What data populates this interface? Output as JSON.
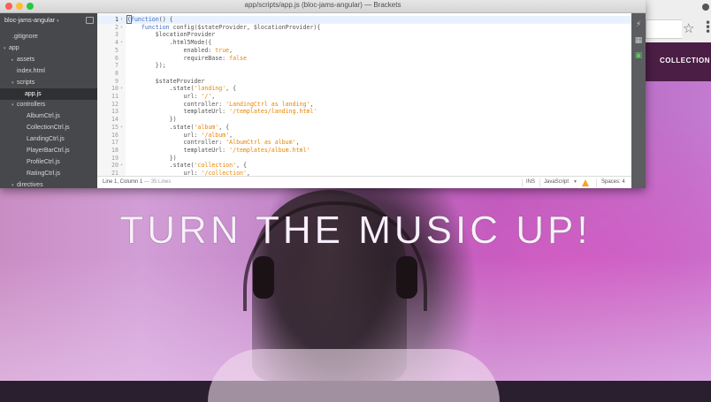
{
  "window": {
    "title": "app/scripts/app.js (bloc-jams-angular) — Brackets"
  },
  "sidebar": {
    "project_title": "bloc-jams-angular",
    "items": [
      {
        "label": ".gitignore",
        "arrow": ""
      },
      {
        "label": "app",
        "arrow": "▾"
      },
      {
        "label": "assets",
        "arrow": "▸"
      },
      {
        "label": "index.html",
        "arrow": ""
      },
      {
        "label": "scripts",
        "arrow": "▾"
      },
      {
        "label": "app.js",
        "arrow": ""
      },
      {
        "label": "controllers",
        "arrow": "▾"
      },
      {
        "label": "AlbumCtrl.js",
        "arrow": ""
      },
      {
        "label": "CollectionCtrl.js",
        "arrow": ""
      },
      {
        "label": "LandingCtrl.js",
        "arrow": ""
      },
      {
        "label": "PlayerBarCtrl.js",
        "arrow": ""
      },
      {
        "label": "ProfileCtrl.js",
        "arrow": ""
      },
      {
        "label": "RatingCtrl.js",
        "arrow": ""
      },
      {
        "label": "directives",
        "arrow": "▾"
      }
    ]
  },
  "editor": {
    "lines": [
      {
        "n": "1",
        "fold": "▾",
        "tokens": [
          {
            "t": "(",
            "c": "cursor"
          },
          {
            "t": "function",
            "c": "kw"
          },
          {
            "t": "() {",
            "c": "plain"
          }
        ]
      },
      {
        "n": "2",
        "fold": "▾",
        "tokens": [
          {
            "t": "    ",
            "c": "plain"
          },
          {
            "t": "function",
            "c": "kw"
          },
          {
            "t": " config($stateProvider, $locationProvider){",
            "c": "plain"
          }
        ]
      },
      {
        "n": "3",
        "fold": "",
        "tokens": [
          {
            "t": "        $locationProvider",
            "c": "plain"
          }
        ]
      },
      {
        "n": "4",
        "fold": "▾",
        "tokens": [
          {
            "t": "            .html5Mode({",
            "c": "plain"
          }
        ]
      },
      {
        "n": "5",
        "fold": "",
        "tokens": [
          {
            "t": "                enabled: ",
            "c": "plain"
          },
          {
            "t": "true",
            "c": "bool"
          },
          {
            "t": ",",
            "c": "plain"
          }
        ]
      },
      {
        "n": "6",
        "fold": "",
        "tokens": [
          {
            "t": "                requireBase: ",
            "c": "plain"
          },
          {
            "t": "false",
            "c": "bool"
          }
        ]
      },
      {
        "n": "7",
        "fold": "",
        "tokens": [
          {
            "t": "        });",
            "c": "plain"
          }
        ]
      },
      {
        "n": "8",
        "fold": "",
        "tokens": []
      },
      {
        "n": "9",
        "fold": "",
        "tokens": [
          {
            "t": "        $stateProvider",
            "c": "plain"
          }
        ]
      },
      {
        "n": "10",
        "fold": "▾",
        "tokens": [
          {
            "t": "            .state(",
            "c": "plain"
          },
          {
            "t": "'landing'",
            "c": "str"
          },
          {
            "t": ", {",
            "c": "plain"
          }
        ]
      },
      {
        "n": "11",
        "fold": "",
        "tokens": [
          {
            "t": "                url: ",
            "c": "plain"
          },
          {
            "t": "'/'",
            "c": "str"
          },
          {
            "t": ",",
            "c": "plain"
          }
        ]
      },
      {
        "n": "12",
        "fold": "",
        "tokens": [
          {
            "t": "                controller: ",
            "c": "plain"
          },
          {
            "t": "'LandingCtrl as landing'",
            "c": "str"
          },
          {
            "t": ",",
            "c": "plain"
          }
        ]
      },
      {
        "n": "13",
        "fold": "",
        "tokens": [
          {
            "t": "                templateUrl: ",
            "c": "plain"
          },
          {
            "t": "'/templates/landing.html'",
            "c": "str"
          }
        ]
      },
      {
        "n": "14",
        "fold": "",
        "tokens": [
          {
            "t": "            })",
            "c": "plain"
          }
        ]
      },
      {
        "n": "15",
        "fold": "▾",
        "tokens": [
          {
            "t": "            .state(",
            "c": "plain"
          },
          {
            "t": "'album'",
            "c": "str"
          },
          {
            "t": ", {",
            "c": "plain"
          }
        ]
      },
      {
        "n": "16",
        "fold": "",
        "tokens": [
          {
            "t": "                url: ",
            "c": "plain"
          },
          {
            "t": "'/album'",
            "c": "str"
          },
          {
            "t": ",",
            "c": "plain"
          }
        ]
      },
      {
        "n": "17",
        "fold": "",
        "tokens": [
          {
            "t": "                controller: ",
            "c": "plain"
          },
          {
            "t": "'AlbumCtrl as album'",
            "c": "str"
          },
          {
            "t": ",",
            "c": "plain"
          }
        ]
      },
      {
        "n": "18",
        "fold": "",
        "tokens": [
          {
            "t": "                templateUrl: ",
            "c": "plain"
          },
          {
            "t": "'/templates/album.html'",
            "c": "str"
          }
        ]
      },
      {
        "n": "19",
        "fold": "",
        "tokens": [
          {
            "t": "            })",
            "c": "plain"
          }
        ]
      },
      {
        "n": "20",
        "fold": "▾",
        "tokens": [
          {
            "t": "            .state(",
            "c": "plain"
          },
          {
            "t": "'collection'",
            "c": "str"
          },
          {
            "t": ", {",
            "c": "plain"
          }
        ]
      },
      {
        "n": "21",
        "fold": "",
        "tokens": [
          {
            "t": "                url: ",
            "c": "plain"
          },
          {
            "t": "'/collection'",
            "c": "str"
          },
          {
            "t": ",",
            "c": "plain"
          }
        ]
      }
    ]
  },
  "status": {
    "cursor": "Line 1, Column 1",
    "lines": " — 35 Lines",
    "mode": "INS",
    "language": "JavaScript",
    "spaces": "Spaces:  4"
  },
  "website": {
    "nav_link": "COLLECTION",
    "hero": "TURN THE MUSIC UP!"
  }
}
